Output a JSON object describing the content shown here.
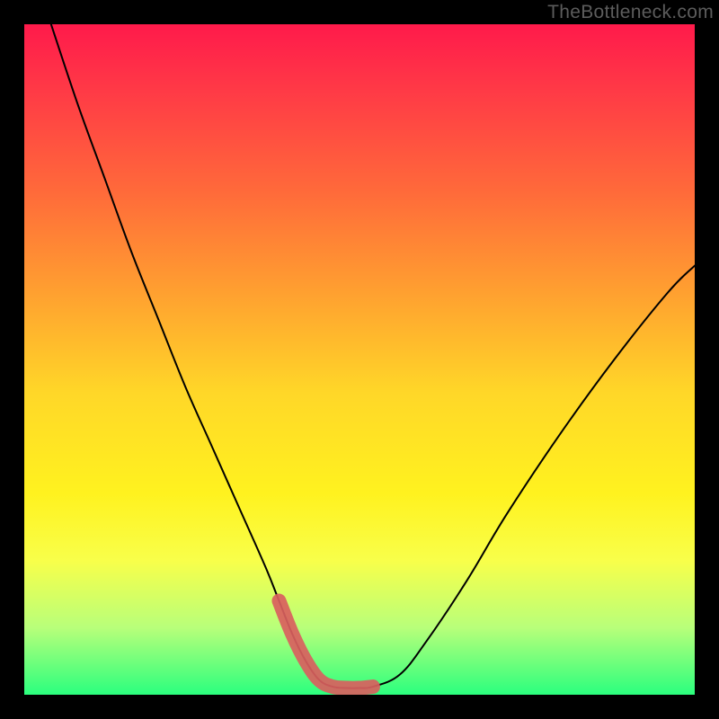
{
  "watermark": "TheBottleneck.com",
  "chart_data": {
    "type": "line",
    "title": "",
    "xlabel": "",
    "ylabel": "",
    "xlim": [
      0,
      100
    ],
    "ylim": [
      0,
      100
    ],
    "series": [
      {
        "name": "curve",
        "x": [
          4,
          8,
          12,
          16,
          20,
          24,
          28,
          32,
          36,
          38,
          40,
          42,
          44,
          46,
          48,
          50,
          52,
          56,
          60,
          66,
          72,
          80,
          88,
          96,
          100
        ],
        "y": [
          100,
          88,
          77,
          66,
          56,
          46,
          37,
          28,
          19,
          14,
          9,
          5,
          2.2,
          1.2,
          1,
          1,
          1.2,
          3,
          8,
          17,
          27,
          39,
          50,
          60,
          64
        ]
      },
      {
        "name": "highlight",
        "x": [
          38,
          40,
          42,
          44,
          46,
          48,
          50,
          52
        ],
        "y": [
          14,
          9,
          5,
          2.2,
          1.2,
          1,
          1,
          1.2
        ]
      }
    ],
    "background_gradient": {
      "top": "#ff1a4b",
      "mid": "#fff21f",
      "bottom": "#2bff7e"
    }
  }
}
